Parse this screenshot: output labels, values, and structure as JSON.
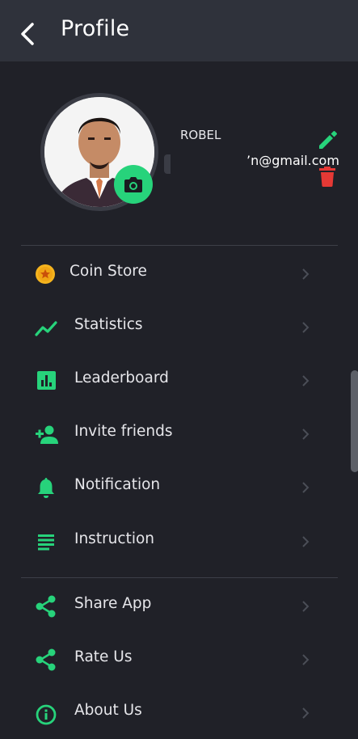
{
  "header": {
    "title": "Profile"
  },
  "profile": {
    "username": "ROBEL",
    "email": "’n@gmail.com"
  },
  "menu_primary": [
    {
      "label": "Coin Store",
      "icon": "coin-icon"
    },
    {
      "label": "Statistics",
      "icon": "trending-up-icon"
    },
    {
      "label": "Leaderboard",
      "icon": "leaderboard-icon"
    },
    {
      "label": "Invite friends",
      "icon": "person-add-icon"
    },
    {
      "label": "Notification",
      "icon": "bell-icon"
    },
    {
      "label": "Instruction",
      "icon": "notes-icon"
    }
  ],
  "menu_secondary": [
    {
      "label": "Share App",
      "icon": "share-icon"
    },
    {
      "label": "Rate Us",
      "icon": "share-icon"
    },
    {
      "label": "About Us",
      "icon": "info-icon"
    }
  ],
  "colors": {
    "accent": "#27d37b",
    "danger": "#e53935",
    "coin": "#f5b41e",
    "background": "#202128",
    "header": "#2f323b"
  }
}
